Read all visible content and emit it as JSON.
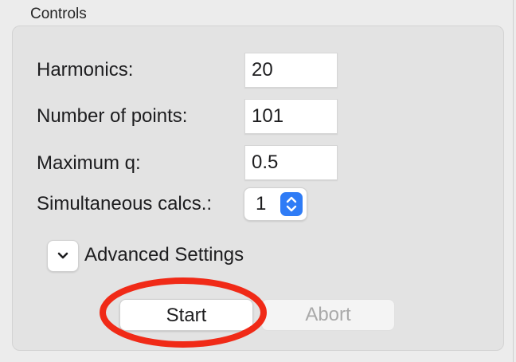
{
  "group": {
    "title": "Controls"
  },
  "fields": {
    "harmonics": {
      "label": "Harmonics:",
      "value": "20"
    },
    "num_points": {
      "label": "Number of points:",
      "value": "101"
    },
    "max_q": {
      "label": "Maximum q:",
      "value": "0.5"
    },
    "simultaneous": {
      "label": "Simultaneous calcs.:",
      "value": "1"
    }
  },
  "advanced": {
    "label": "Advanced Settings",
    "icon": "chevron-down-icon"
  },
  "buttons": {
    "start": "Start",
    "abort": "Abort"
  },
  "icons": {
    "stepper": "stepper-arrows-icon"
  },
  "colors": {
    "accent": "#2f7cf6",
    "highlight_ring": "#f02a17",
    "disabled_text": "#a9a9a9"
  }
}
